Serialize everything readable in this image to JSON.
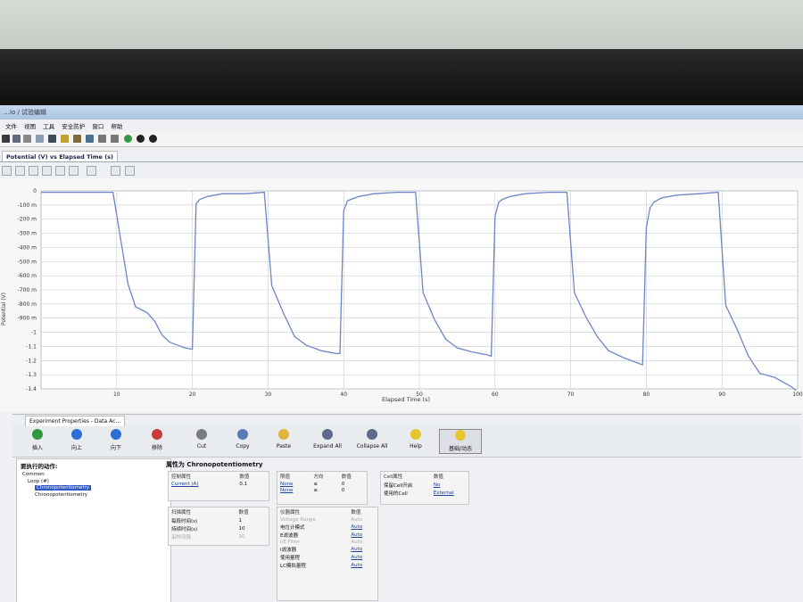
{
  "app": {
    "title_text": "…io / 试验编辑"
  },
  "menu": {
    "items": [
      "文件",
      "视图",
      "工具",
      "安全防护",
      "窗口",
      "帮助"
    ]
  },
  "chart_tab": {
    "label": "Potential (V) vs Elapsed Time (s)"
  },
  "chart_data": {
    "type": "line",
    "title": "",
    "xlabel": "Elapsed Time (s)",
    "ylabel": "Potential (V)",
    "xlim": [
      0,
      100
    ],
    "ylim": [
      -1.4,
      0
    ],
    "xticks": [
      10,
      20,
      30,
      40,
      50,
      60,
      70,
      80,
      90,
      100
    ],
    "yticks": [
      {
        "v": 0,
        "label": "0"
      },
      {
        "v": -0.1,
        "label": "-100 m"
      },
      {
        "v": -0.2,
        "label": "-200 m"
      },
      {
        "v": -0.3,
        "label": "-300 m"
      },
      {
        "v": -0.4,
        "label": "-400 m"
      },
      {
        "v": -0.5,
        "label": "-500 m"
      },
      {
        "v": -0.6,
        "label": "-600 m"
      },
      {
        "v": -0.7,
        "label": "-700 m"
      },
      {
        "v": -0.8,
        "label": "-800 m"
      },
      {
        "v": -0.9,
        "label": "-900 m"
      },
      {
        "v": -1.0,
        "label": "-1"
      },
      {
        "v": -1.1,
        "label": "-1.1"
      },
      {
        "v": -1.2,
        "label": "-1.2"
      },
      {
        "v": -1.3,
        "label": "-1.3"
      },
      {
        "v": -1.4,
        "label": "-1.4"
      }
    ],
    "grid": true,
    "series": [
      {
        "color": "#6d85c8",
        "x": [
          0,
          9.5,
          11.5,
          12.5,
          14,
          15,
          16,
          17,
          18,
          19,
          20,
          20.5,
          21,
          22,
          24,
          27,
          29.5,
          30.5,
          32,
          33.5,
          35,
          37,
          39,
          39.5,
          40,
          40.5,
          41,
          42,
          44,
          47,
          49.5,
          50.5,
          52,
          53.5,
          55,
          57,
          59,
          59.5,
          60,
          60.5,
          61,
          62,
          64,
          67,
          69.5,
          70.5,
          72,
          73.5,
          75,
          77,
          79,
          79.5,
          80,
          80.5,
          81,
          82,
          84,
          87,
          89.5,
          90.5,
          92,
          93.5,
          95,
          97,
          99,
          99.8
        ],
        "y": [
          -0.01,
          -0.01,
          -0.66,
          -0.82,
          -0.86,
          -0.92,
          -1.02,
          -1.07,
          -1.09,
          -1.11,
          -1.12,
          -0.09,
          -0.06,
          -0.04,
          -0.02,
          -0.02,
          -0.01,
          -0.67,
          -0.86,
          -1.03,
          -1.09,
          -1.13,
          -1.15,
          -1.15,
          -0.14,
          -0.07,
          -0.06,
          -0.04,
          -0.02,
          -0.01,
          -0.01,
          -0.72,
          -0.91,
          -1.05,
          -1.11,
          -1.14,
          -1.16,
          -1.17,
          -0.18,
          -0.08,
          -0.06,
          -0.04,
          -0.02,
          -0.01,
          -0.01,
          -0.72,
          -0.89,
          -1.03,
          -1.13,
          -1.18,
          -1.22,
          -1.23,
          -0.26,
          -0.12,
          -0.08,
          -0.05,
          -0.03,
          -0.02,
          -0.01,
          -0.81,
          -0.98,
          -1.17,
          -1.29,
          -1.32,
          -1.38,
          -1.41
        ]
      }
    ]
  },
  "props_tab": {
    "label": "Experiment Properties - Data Ac..."
  },
  "actions": [
    {
      "label": "插入",
      "color": "#2e9a3a"
    },
    {
      "label": "向上",
      "color": "#2a6fd6"
    },
    {
      "label": "向下",
      "color": "#2a6fd6"
    },
    {
      "label": "移除",
      "color": "#c83b3b"
    },
    {
      "label": "Cut",
      "color": "#7b7b7b"
    },
    {
      "label": "Copy",
      "color": "#5a7bb8"
    },
    {
      "label": "Paste",
      "color": "#e0b33a"
    },
    {
      "label": "Expand All",
      "color": "#5a6a88"
    },
    {
      "label": "Collapse All",
      "color": "#5a6a88"
    },
    {
      "label": "Help",
      "color": "#e7c531"
    },
    {
      "label": "基础/动态",
      "color": "#e7c531"
    }
  ],
  "left_panel": {
    "title": "要执行的动作:",
    "tree": [
      "Common",
      "Loop (#)",
      "Chronopotentiometry",
      "Chronopotentiometry"
    ]
  },
  "properties": {
    "title": "属性为 Chronopotentiometry",
    "control": {
      "headers": [
        "控制属性",
        "数值"
      ],
      "rows": [
        [
          "Current (A)",
          "0.1"
        ]
      ]
    },
    "limits": {
      "headers": [
        "限值",
        "方向",
        "数值"
      ],
      "rows": [
        [
          "None",
          "≤",
          "0"
        ],
        [
          "None",
          "≤",
          "0"
        ]
      ]
    },
    "cell": {
      "headers": [
        "Cell属性",
        "数值"
      ],
      "rows": [
        [
          "保留Cell开启",
          "No"
        ],
        [
          "使用的Cell",
          "External"
        ]
      ]
    },
    "sampling": {
      "headers": [
        "扫描属性",
        "数值"
      ],
      "rows": [
        [
          "每段时间(s)",
          "1"
        ],
        [
          "持续时间(s)",
          "10"
        ],
        [
          "采样间隔",
          "10"
        ]
      ]
    },
    "instrument": {
      "headers": [
        "仪器属性",
        "数值"
      ],
      "rows": [
        [
          "Voltage Range",
          "Auto"
        ],
        [
          "电位计模式",
          "Auto"
        ],
        [
          "E滤波器",
          "Auto"
        ],
        [
          "I/E Filter",
          "Auto"
        ],
        [
          "I滤波器",
          "Auto"
        ],
        [
          "使用量程",
          "Auto"
        ],
        [
          "LC模拟量程",
          "Auto"
        ]
      ]
    }
  }
}
